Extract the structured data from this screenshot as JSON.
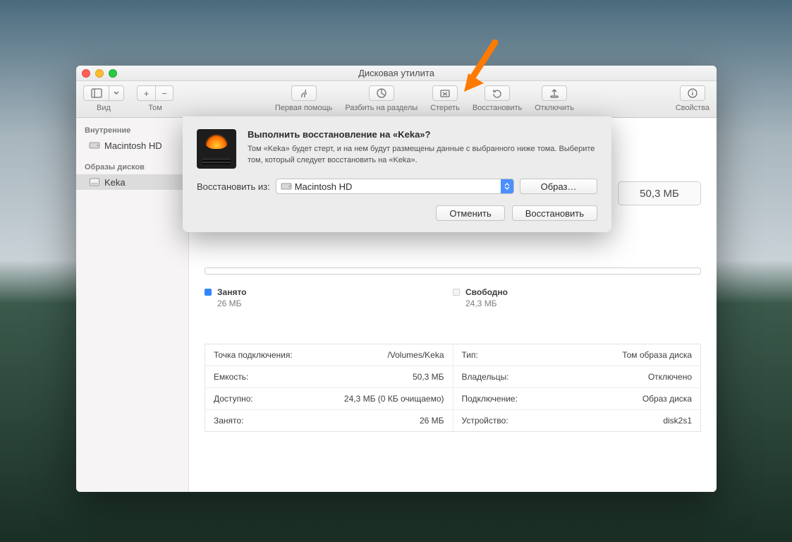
{
  "window": {
    "title": "Дисковая утилита"
  },
  "toolbar": {
    "view": "Вид",
    "volume": "Том",
    "first_aid": "Первая помощь",
    "partition": "Разбить на разделы",
    "erase": "Стереть",
    "restore": "Восстановить",
    "unmount": "Отключить",
    "info": "Свойства"
  },
  "sidebar": {
    "internal_header": "Внутренние",
    "internal_items": [
      {
        "label": "Macintosh HD"
      }
    ],
    "images_header": "Образы дисков",
    "image_items": [
      {
        "label": "Keka",
        "selected": true
      }
    ]
  },
  "summary": {
    "size": "50,3 МБ"
  },
  "usage": {
    "used_label": "Занято",
    "used_value": "26 МБ",
    "free_label": "Свободно",
    "free_value": "24,3 МБ"
  },
  "props_left": [
    {
      "k": "Точка подключения:",
      "v": "/Volumes/Keka"
    },
    {
      "k": "Емкость:",
      "v": "50,3 МБ"
    },
    {
      "k": "Доступно:",
      "v": "24,3 МБ (0 КБ очищаемо)"
    },
    {
      "k": "Занято:",
      "v": "26 МБ"
    }
  ],
  "props_right": [
    {
      "k": "Тип:",
      "v": "Том образа диска"
    },
    {
      "k": "Владельцы:",
      "v": "Отключено"
    },
    {
      "k": "Подключение:",
      "v": "Образ диска"
    },
    {
      "k": "Устройство:",
      "v": "disk2s1"
    }
  ],
  "dialog": {
    "title": "Выполнить восстановление на «Keka»?",
    "desc": "Том «Keka» будет стерт, и на нем будут размещены данные с выбранного ниже тома. Выберите том, который следует восстановить на «Keka».",
    "restore_from_label": "Восстановить из:",
    "source_selected": "Macintosh HD",
    "image_button": "Образ…",
    "cancel": "Отменить",
    "restore": "Восстановить"
  }
}
